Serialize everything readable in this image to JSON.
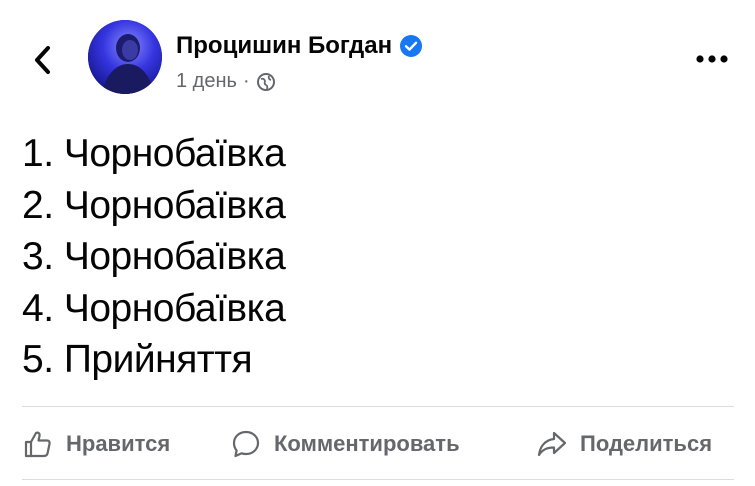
{
  "post": {
    "author": {
      "name": "Процишин Богдан",
      "verified": true
    },
    "meta": {
      "time": "1 день",
      "separator": "·",
      "privacy_icon": "globe-icon"
    },
    "lines": [
      "1. Чорнобаївка",
      "2. Чорнобаївка",
      "3. Чорнобаївка",
      "4. Чорнобаївка",
      "5. Прийняття"
    ]
  },
  "actions": {
    "like_label": "Нравится",
    "comment_label": "Комментировать",
    "share_label": "Поделиться"
  },
  "icons": {
    "back": "back-arrow-icon",
    "more": "more-options-icon",
    "verified": "verified-badge-icon",
    "like": "thumbs-up-icon",
    "comment": "comment-bubble-icon",
    "share": "share-arrow-icon"
  },
  "colors": {
    "text_primary": "#050505",
    "text_secondary": "#65676b",
    "verified_blue": "#1877f2",
    "divider": "#dadde1"
  }
}
